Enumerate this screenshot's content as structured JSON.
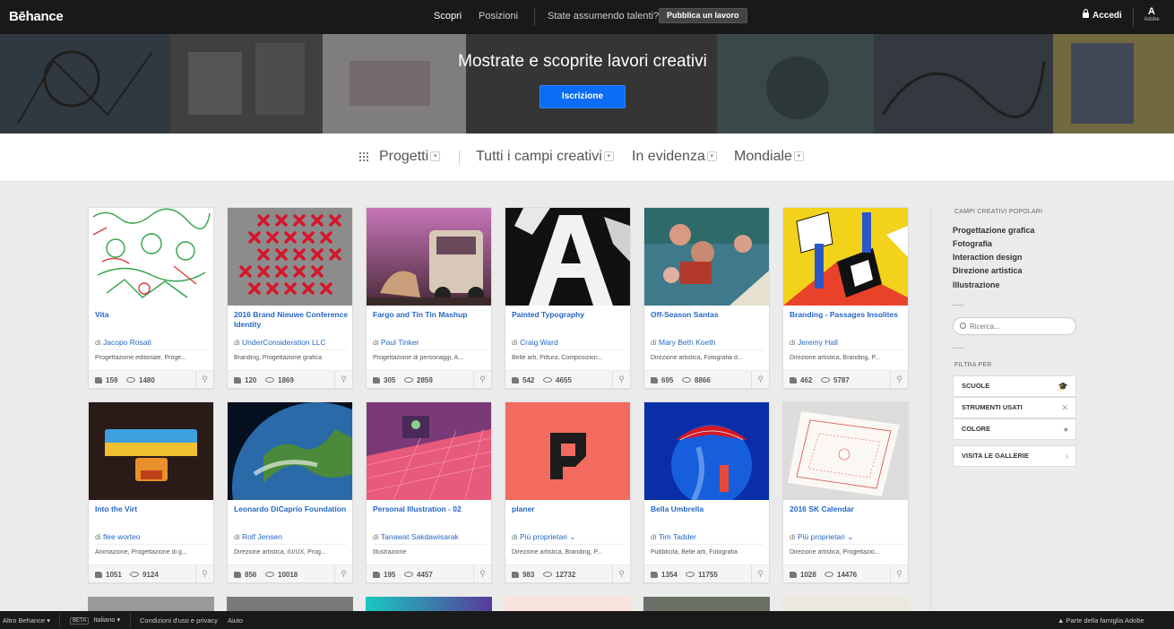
{
  "nav": {
    "logo": "Bēhance",
    "discover": "Scopri",
    "jobs": "Posizioni",
    "hiring": "State assumendo talenti?",
    "post_job": "Pubblica un lavoro",
    "login": "Accedi",
    "adobe_mark": "A",
    "adobe_word": "Adobe"
  },
  "hero": {
    "title": "Mostrate e scoprite lavori creativi",
    "signup": "Iscrizione"
  },
  "filters": {
    "projects": "Progetti",
    "fields": "Tutti i campi creativi",
    "featured": "In evidenza",
    "location": "Mondiale"
  },
  "cards": [
    {
      "title": "Vita",
      "by": "di",
      "owner": "Jacopo Rosati",
      "fields": "Progettazione editoriale, Proge...",
      "likes": "159",
      "views": "1480"
    },
    {
      "title": "2016 Brand Nieuwe Conference Identity",
      "by": "di",
      "owner": "UnderConsideration LLC",
      "fields": "Branding, Progettazione grafica",
      "likes": "120",
      "views": "1869"
    },
    {
      "title": "Fargo and Tin Tin Mashup",
      "by": "di",
      "owner": "Paul Tinker",
      "fields": "Progettazione di personaggi, A...",
      "likes": "305",
      "views": "2859"
    },
    {
      "title": "Painted Typography",
      "by": "di",
      "owner": "Craig Ward",
      "fields": "Belle arti, Pittura, Composizion...",
      "likes": "542",
      "views": "4655"
    },
    {
      "title": "Off-Season Santas",
      "by": "di",
      "owner": "Mary Beth Koeth",
      "fields": "Direzione artistica, Fotografia d...",
      "likes": "695",
      "views": "8866"
    },
    {
      "title": "Branding - Passages Insolites",
      "by": "di",
      "owner": "Jeremy Hall",
      "fields": "Direzione artistica, Branding, P...",
      "likes": "462",
      "views": "5787"
    },
    {
      "title": "Into the Virt",
      "by": "di",
      "owner": "flee worteo",
      "fields": "Animazione, Progettazione di g...",
      "likes": "1051",
      "views": "9124"
    },
    {
      "title": "Leonardo DiCaprio Foundation",
      "by": "di",
      "owner": "Rolf Jensen",
      "fields": "Direzione artistica, IU/UX, Prog...",
      "likes": "856",
      "views": "10018"
    },
    {
      "title": "Personal Illustration - 02",
      "by": "di",
      "owner": "Tanawat Sakdawisarak",
      "fields": "Illustrazione",
      "likes": "195",
      "views": "4457"
    },
    {
      "title": "planer",
      "by": "di",
      "owner": "Più proprietari",
      "fields": "Direzione artistica, Branding, P...",
      "likes": "983",
      "views": "12732"
    },
    {
      "title": "Bella Umbrella",
      "by": "di",
      "owner": "Tim Tadder",
      "fields": "Pubblicità, Belle arti, Fotografia",
      "likes": "1354",
      "views": "11755"
    },
    {
      "title": "2016 SK Calendar",
      "by": "di",
      "owner": "Più proprietari",
      "fields": "Direzione artistica, Progettazio...",
      "likes": "1028",
      "views": "14476"
    }
  ],
  "sidebar": {
    "popular_heading": "CAMPI CREATIVI POPOLARI",
    "popular": [
      "Progettazione grafica",
      "Fotografia",
      "Interaction design",
      "Direzione artistica",
      "Illustrazione"
    ],
    "search_placeholder": "Ricerca...",
    "filter_heading": "FILTRA PER",
    "filters": [
      "SCUOLE",
      "STRUMENTI USATI",
      "COLORE"
    ],
    "galleries": "VISITA LE GALLERIE"
  },
  "footer": {
    "more": "Altro Behance",
    "beta": "BETA",
    "language": "Italiano",
    "terms": "Condizioni d'uso e privacy",
    "help": "Aiuto",
    "family": "Parte della famiglia Adobe"
  }
}
